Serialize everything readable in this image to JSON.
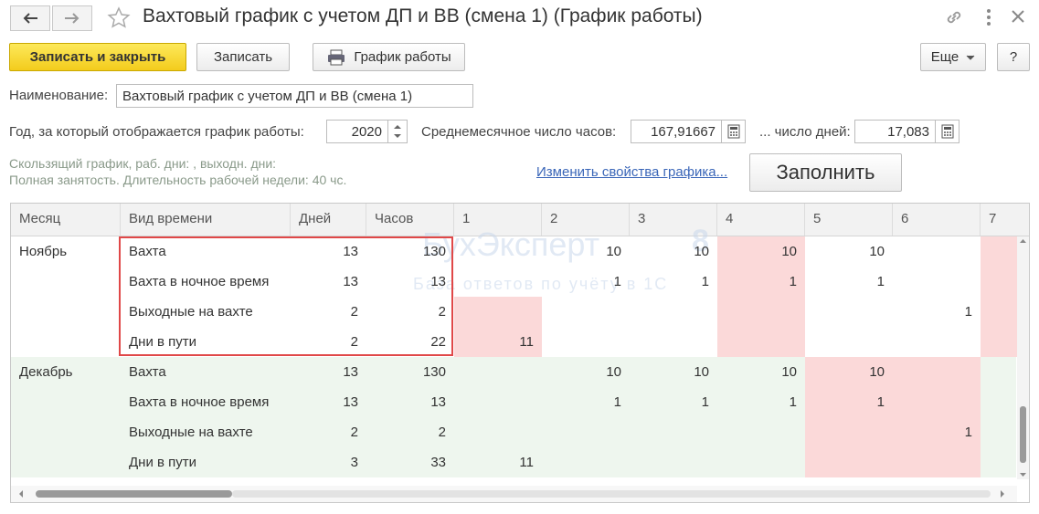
{
  "window": {
    "title": "Вахтовый график с учетом ДП и ВВ (смена 1) (График работы)"
  },
  "toolbar": {
    "save_close": "Записать и закрыть",
    "save": "Записать",
    "schedule": "График работы",
    "more": "Еще",
    "help": "?"
  },
  "form": {
    "name_label": "Наименование:",
    "name_value": "Вахтовый график с учетом ДП и ВВ (смена 1)",
    "year_label": "Год, за который отображается график работы:",
    "year_value": "2020",
    "avg_hours_label": "Среднемесячное число часов:",
    "avg_hours_value": "167,91667",
    "days_label": "... число дней:",
    "days_value": "17,083",
    "info_line1": "Скользящий график, раб. дни: , выходн. дни:",
    "info_line2": "Полная занятость. Длительность рабочей недели: 40 чс.",
    "change_link": "Изменить свойства графика...",
    "fill_button": "Заполнить"
  },
  "watermark": {
    "brand": "БухЭксперт",
    "digit": "8",
    "tagline": "База ответов по учёту в 1С"
  },
  "table": {
    "columns": [
      "Месяц",
      "Вид времени",
      "Дней",
      "Часов",
      "1",
      "2",
      "3",
      "4",
      "5",
      "6",
      "7"
    ],
    "months": [
      {
        "month": "Ноябрь",
        "rows": [
          {
            "type": "Вахта",
            "days": "13",
            "hours": "130",
            "d": [
              "",
              "10",
              "10",
              "10",
              "10",
              "",
              ""
            ]
          },
          {
            "type": "Вахта в ночное время",
            "days": "13",
            "hours": "13",
            "d": [
              "",
              "1",
              "1",
              "1",
              "1",
              "",
              ""
            ]
          },
          {
            "type": "Выходные на вахте",
            "days": "2",
            "hours": "2",
            "d": [
              "",
              "",
              "",
              "",
              "",
              "1",
              ""
            ]
          },
          {
            "type": "Дни в пути",
            "days": "2",
            "hours": "22",
            "d": [
              "11",
              "",
              "",
              "",
              "",
              "",
              ""
            ]
          }
        ]
      },
      {
        "month": "Декабрь",
        "rows": [
          {
            "type": "Вахта",
            "days": "13",
            "hours": "130",
            "d": [
              "",
              "10",
              "10",
              "10",
              "10",
              "",
              ""
            ]
          },
          {
            "type": "Вахта в ночное время",
            "days": "13",
            "hours": "13",
            "d": [
              "",
              "1",
              "1",
              "1",
              "1",
              "",
              ""
            ]
          },
          {
            "type": "Выходные на вахте",
            "days": "2",
            "hours": "2",
            "d": [
              "",
              "",
              "",
              "",
              "",
              "1",
              ""
            ]
          },
          {
            "type": "Дни в пути",
            "days": "3",
            "hours": "33",
            "d": [
              "11",
              "",
              "",
              "",
              "",
              "",
              ""
            ]
          }
        ]
      }
    ]
  },
  "colors": {
    "accent_yellow": "#f5d327",
    "weekend_pink": "#fbd9d9",
    "december_green": "#eef6ee",
    "selection_red": "#e04848",
    "link_blue": "#3a66b8"
  }
}
